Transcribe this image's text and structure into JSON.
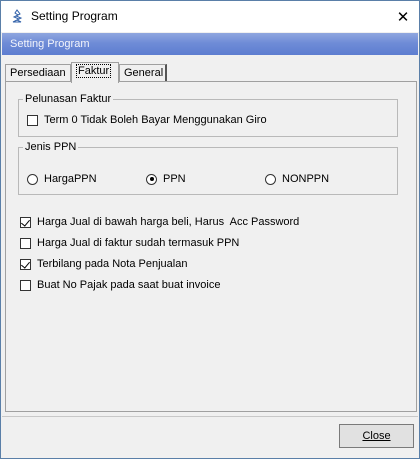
{
  "window": {
    "title": "Setting Program",
    "icon": "app-icon",
    "close_glyph": "✕"
  },
  "header": {
    "text": "Setting Program",
    "gradient": [
      "#8fa6df",
      "#5d7dd0"
    ]
  },
  "tabs": [
    {
      "label": "Persediaan",
      "active": false
    },
    {
      "label": "Faktur",
      "active": true
    },
    {
      "label": "General",
      "active": false
    }
  ],
  "pelunasan": {
    "title": "Pelunasan Faktur",
    "term0": {
      "label": "Term 0 Tidak Boleh Bayar Menggunakan Giro",
      "checked": false
    }
  },
  "jenis_ppn": {
    "title": "Jenis PPN",
    "options": [
      {
        "label": "HargaPPN",
        "selected": false
      },
      {
        "label": "PPN",
        "selected": true
      },
      {
        "label": "NONPPN",
        "selected": false
      }
    ]
  },
  "options": [
    {
      "label": "Harga Jual di bawah harga beli, Harus  Acc Password",
      "checked": true
    },
    {
      "label": "Harga Jual di faktur sudah termasuk PPN",
      "checked": false
    },
    {
      "label": "Terbilang pada Nota Penjualan",
      "checked": true
    },
    {
      "label": "Buat No Pajak pada saat buat invoice",
      "checked": false
    }
  ],
  "footer": {
    "close_label": "Close"
  }
}
